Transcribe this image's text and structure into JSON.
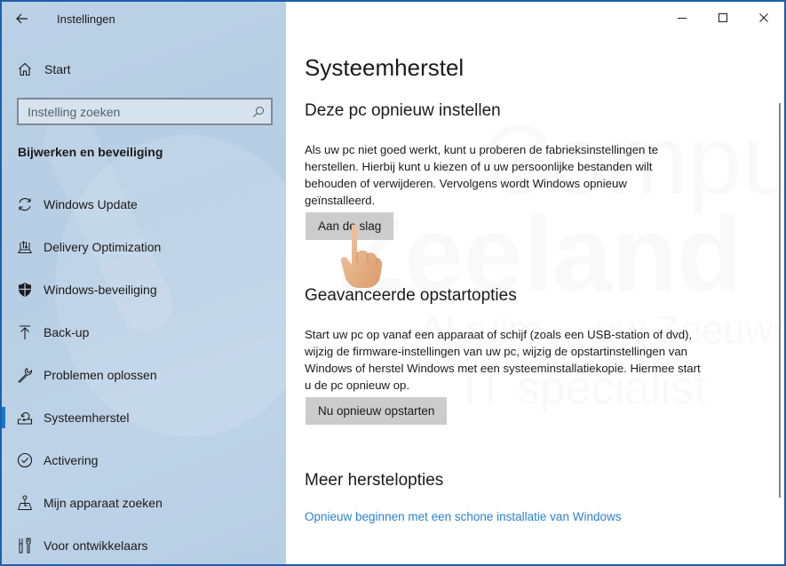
{
  "window": {
    "app_title": "Instellingen",
    "back_icon": "back-arrow-icon",
    "caption": {
      "minimize_icon": "minimize-icon",
      "maximize_icon": "maximize-icon",
      "close_icon": "close-icon"
    }
  },
  "sidebar": {
    "home": {
      "label": "Start",
      "icon": "home-icon"
    },
    "search": {
      "placeholder": "Instelling zoeken",
      "value": "",
      "icon": "search-icon"
    },
    "section_heading": "Bijwerken en beveiliging",
    "items": [
      {
        "label": "Windows Update",
        "icon": "sync-icon",
        "active": false
      },
      {
        "label": "Delivery Optimization",
        "icon": "delivery-optimization-icon",
        "active": false
      },
      {
        "label": "Windows-beveiliging",
        "icon": "shield-icon",
        "active": false
      },
      {
        "label": "Back-up",
        "icon": "upload-arrow-icon",
        "active": false
      },
      {
        "label": "Problemen oplossen",
        "icon": "wrench-icon",
        "active": false
      },
      {
        "label": "Systeemherstel",
        "icon": "recovery-icon",
        "active": true
      },
      {
        "label": "Activering",
        "icon": "check-circle-icon",
        "active": false
      },
      {
        "label": "Mijn apparaat zoeken",
        "icon": "find-device-icon",
        "active": false
      },
      {
        "label": "Voor ontwikkelaars",
        "icon": "developer-tools-icon",
        "active": false
      }
    ],
    "accent_color": "#1e74c8"
  },
  "main": {
    "page_title": "Systeemherstel",
    "sections": [
      {
        "heading": "Deze pc opnieuw instellen",
        "description": "Als uw pc niet goed werkt, kunt u proberen de fabrieksinstellingen te herstellen. Hierbij kunt u kiezen of u uw persoonlijke bestanden wilt behouden of verwijderen. Vervolgens wordt Windows opnieuw geïnstalleerd.",
        "button_label": "Aan de slag"
      },
      {
        "heading": "Geavanceerde opstartopties",
        "description": "Start uw pc op vanaf een apparaat of schijf (zoals een USB-station of dvd), wijzig de firmware-instellingen van uw pc, wijzig de opstartinstellingen van Windows of herstel Windows met een systeeminstallatiekopie. Hiermee start u de pc opnieuw op.",
        "button_label": "Nu opnieuw opstarten"
      },
      {
        "heading": "Meer herstelopties",
        "link_label": "Opnieuw beginnen met een schone installatie van Windows"
      }
    ],
    "link_color": "#2b7fd1",
    "button_color": "#cccccc"
  },
  "overlay": {
    "cursor_icon": "pointing-hand-cursor-icon",
    "watermark_lines": [
      "Computer",
      "Zeeland",
      "Al ruim ... uw Zeeuwse",
      "IT specialist"
    ]
  }
}
